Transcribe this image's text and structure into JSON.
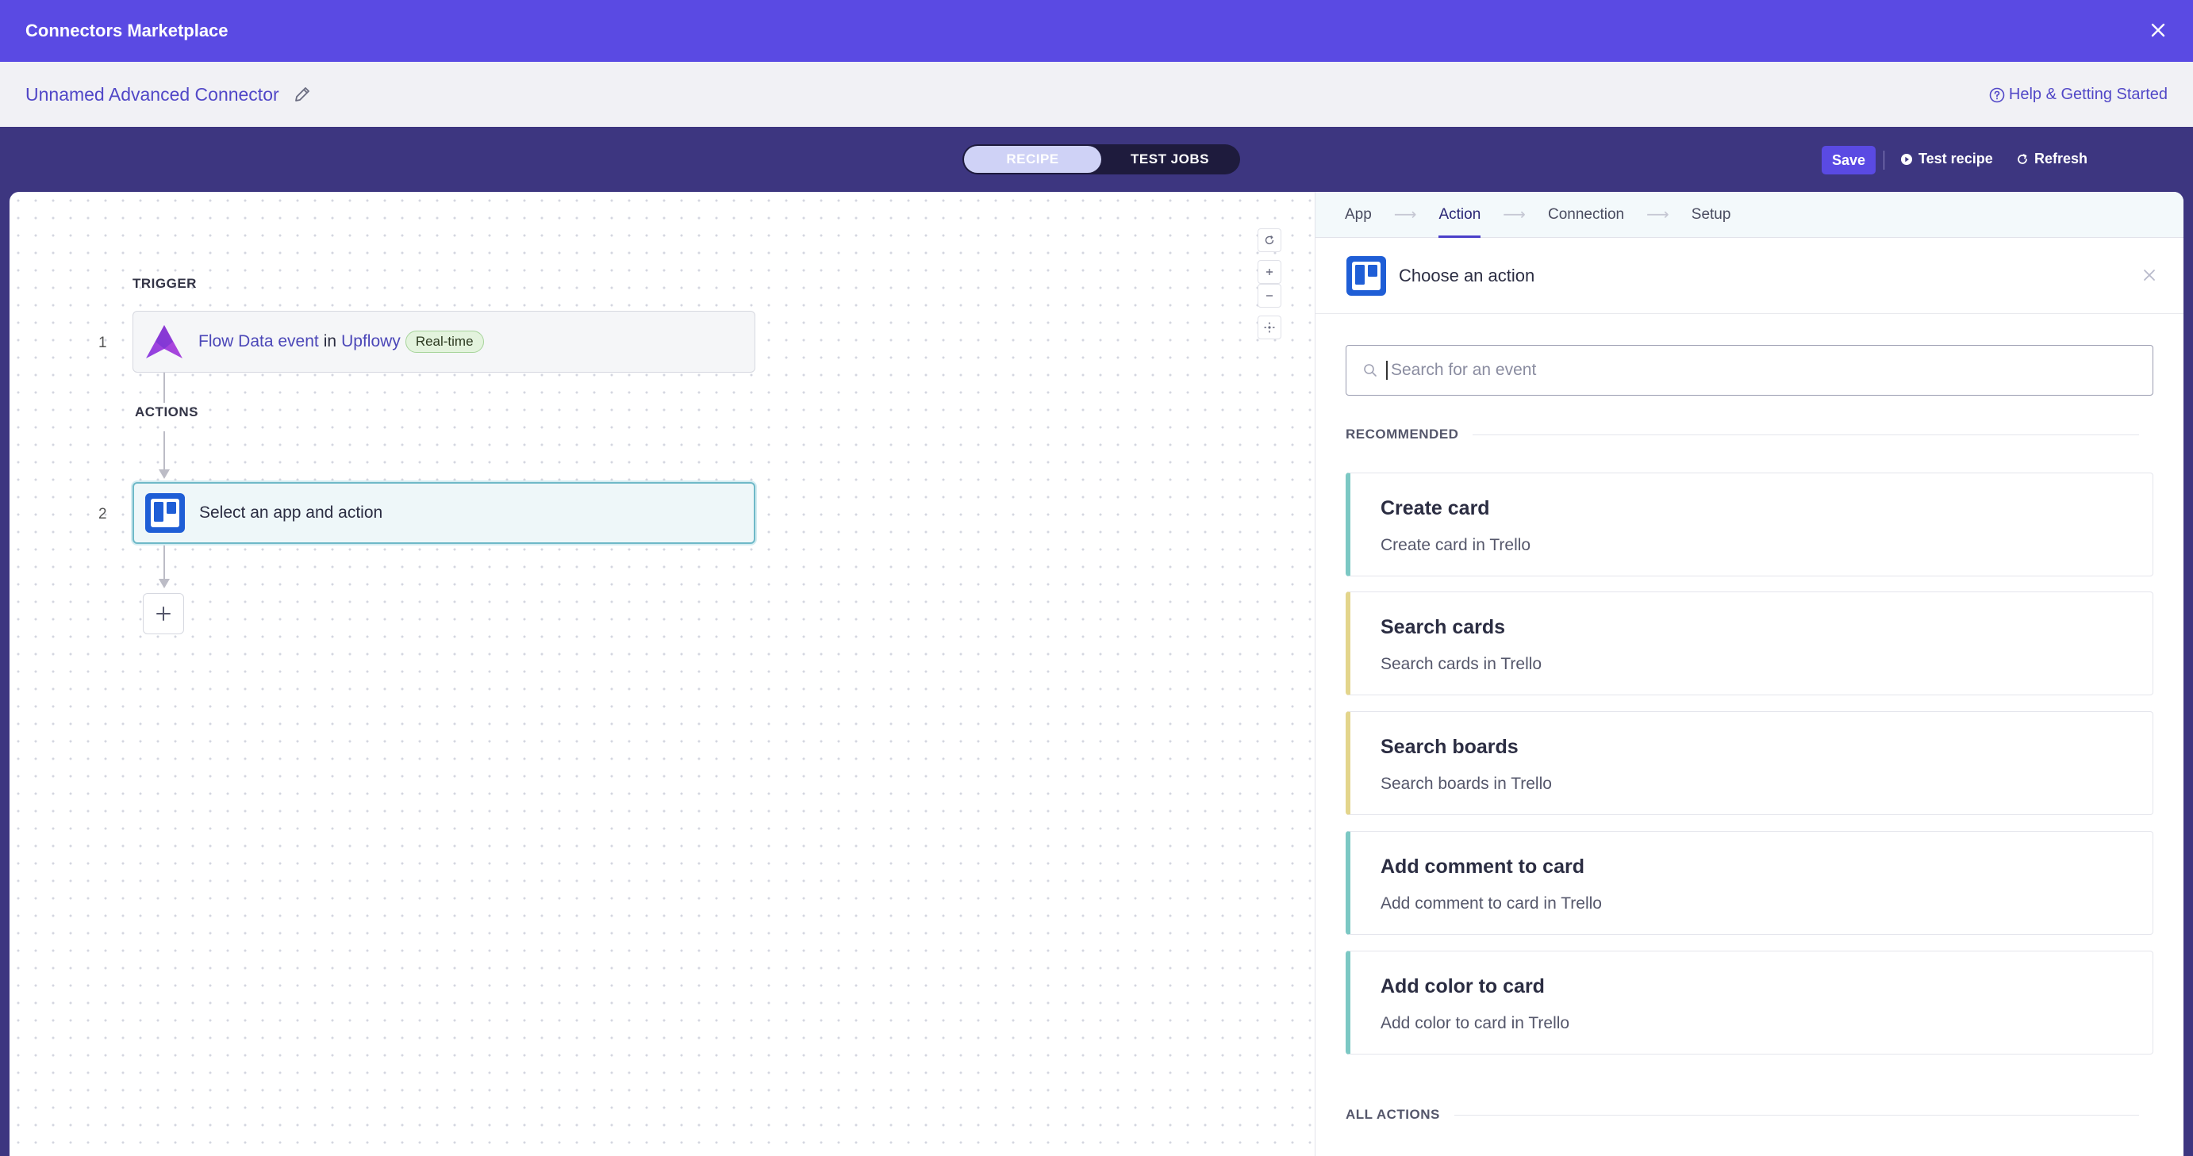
{
  "header": {
    "title": "Connectors Marketplace"
  },
  "namebar": {
    "connector_name": "Unnamed Advanced Connector",
    "help_label": "Help & Getting Started"
  },
  "toolbar": {
    "tabs": [
      {
        "label": "RECIPE",
        "active": true
      },
      {
        "label": "TEST JOBS",
        "active": false
      }
    ],
    "save_label": "Save",
    "test_recipe_label": "Test recipe",
    "refresh_label": "Refresh"
  },
  "canvas": {
    "trigger_label": "TRIGGER",
    "actions_label": "ACTIONS",
    "steps": [
      {
        "number": "1",
        "event": "Flow Data event",
        "connector_word": "in",
        "app": "Upflowy",
        "badge": "Real-time"
      },
      {
        "number": "2",
        "text": "Select an app and action"
      }
    ]
  },
  "panel": {
    "wizard": [
      {
        "label": "App",
        "active": false
      },
      {
        "label": "Action",
        "active": true
      },
      {
        "label": "Connection",
        "active": false
      },
      {
        "label": "Setup",
        "active": false
      }
    ],
    "chooser_label": "Choose an action",
    "search_placeholder": "Search for an event",
    "recommended_label": "RECOMMENDED",
    "all_actions_label": "ALL ACTIONS",
    "actions": [
      {
        "title": "Create card",
        "desc": "Create card in Trello",
        "accent": "#7cc8c4"
      },
      {
        "title": "Search cards",
        "desc": "Search cards in Trello",
        "accent": "#e3d58c"
      },
      {
        "title": "Search boards",
        "desc": "Search boards in Trello",
        "accent": "#e3d58c"
      },
      {
        "title": "Add comment to card",
        "desc": "Add comment to card in Trello",
        "accent": "#7cc8c4"
      },
      {
        "title": "Add color to card",
        "desc": "Add color to card in Trello",
        "accent": "#7cc8c4"
      }
    ]
  },
  "colors": {
    "brand": "#5a4ae3",
    "toolbar_bg": "#3d3680",
    "trello_blue": "#1f5ed6"
  }
}
